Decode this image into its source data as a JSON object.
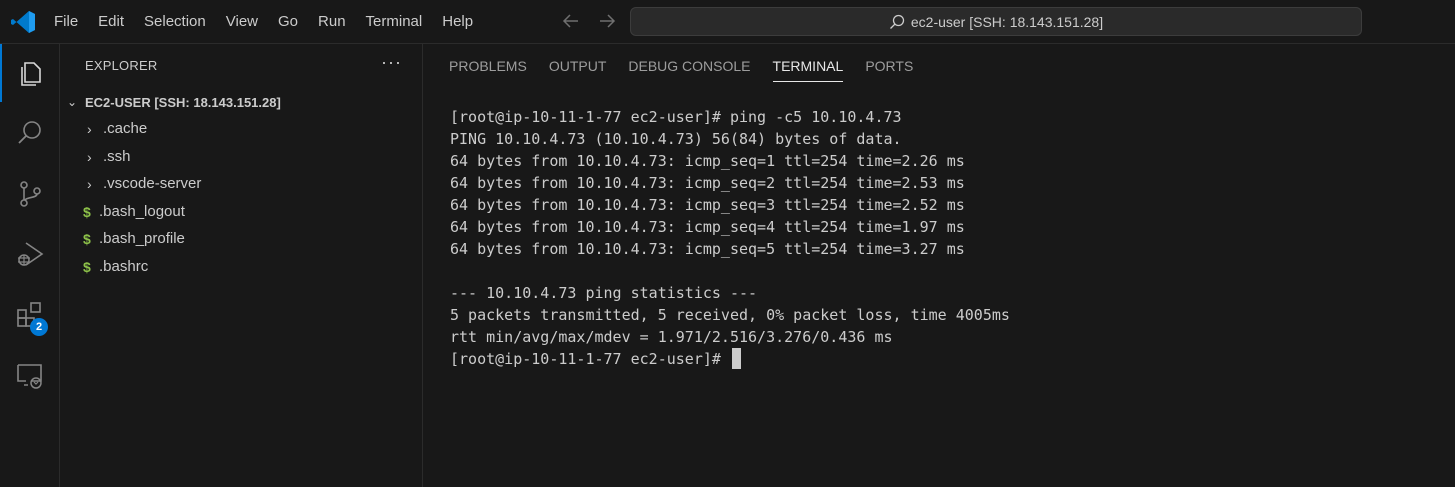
{
  "titlebar": {
    "menu": [
      "File",
      "Edit",
      "Selection",
      "View",
      "Go",
      "Run",
      "Terminal",
      "Help"
    ],
    "back_icon": "arrow-left-icon",
    "forward_icon": "arrow-right-icon",
    "command_center_text": "ec2-user [SSH: 18.143.151.28]"
  },
  "activitybar": {
    "items": [
      "explorer-icon",
      "search-icon",
      "source-control-icon",
      "run-debug-icon",
      "extensions-icon",
      "remote-explorer-icon"
    ],
    "extensions_badge": "2",
    "accent": "#0078d4"
  },
  "sidebar": {
    "title": "EXPLORER",
    "more": "···",
    "root_label": "EC2-USER [SSH: 18.143.151.28]",
    "items": [
      {
        "label": ".cache",
        "type": "folder"
      },
      {
        "label": ".ssh",
        "type": "folder"
      },
      {
        "label": ".vscode-server",
        "type": "folder"
      },
      {
        "label": ".bash_logout",
        "type": "shell"
      },
      {
        "label": ".bash_profile",
        "type": "shell"
      },
      {
        "label": ".bashrc",
        "type": "shell"
      }
    ]
  },
  "panel": {
    "tabs": [
      "PROBLEMS",
      "OUTPUT",
      "DEBUG CONSOLE",
      "TERMINAL",
      "PORTS"
    ],
    "active_tab": "TERMINAL",
    "terminal_lines": [
      "[root@ip-10-11-1-77 ec2-user]# ping -c5 10.10.4.73",
      "PING 10.10.4.73 (10.10.4.73) 56(84) bytes of data.",
      "64 bytes from 10.10.4.73: icmp_seq=1 ttl=254 time=2.26 ms",
      "64 bytes from 10.10.4.73: icmp_seq=2 ttl=254 time=2.53 ms",
      "64 bytes from 10.10.4.73: icmp_seq=3 ttl=254 time=2.52 ms",
      "64 bytes from 10.10.4.73: icmp_seq=4 ttl=254 time=1.97 ms",
      "64 bytes from 10.10.4.73: icmp_seq=5 ttl=254 time=3.27 ms",
      "",
      "--- 10.10.4.73 ping statistics ---",
      "5 packets transmitted, 5 received, 0% packet loss, time 4005ms",
      "rtt min/avg/max/mdev = 1.971/2.516/3.276/0.436 ms"
    ],
    "prompt": "[root@ip-10-11-1-77 ec2-user]# "
  }
}
